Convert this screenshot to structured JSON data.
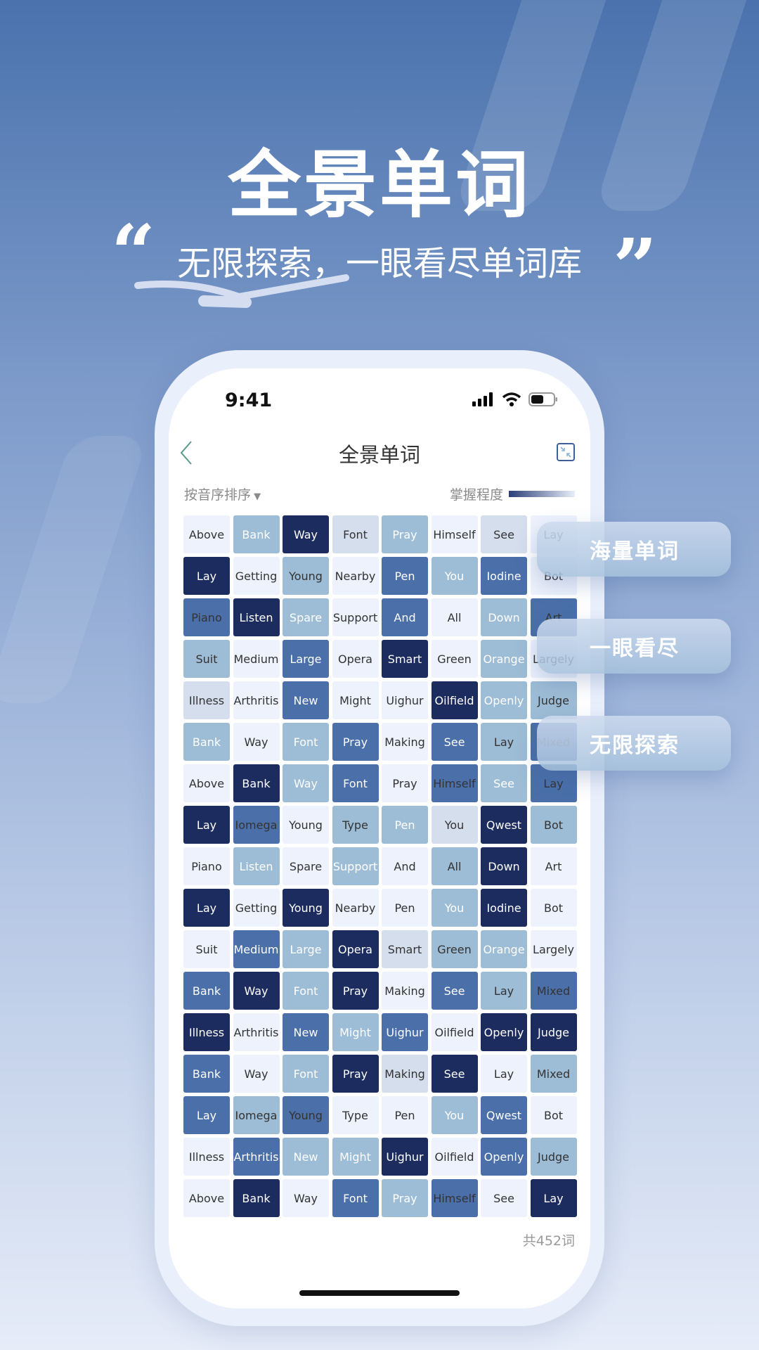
{
  "hero": {
    "title": "全景单词",
    "subtitle": "无限探索，一眼看尽单词库",
    "open_quote": "“",
    "close_quote": "”"
  },
  "status_bar": {
    "time": "9:41",
    "icons": [
      "signal-icon",
      "wifi-icon",
      "battery-icon"
    ]
  },
  "nav": {
    "title": "全景单词",
    "back_icon": "chevron-left-icon",
    "action_icon": "collapse-icon"
  },
  "toolbar": {
    "sort_label": "按音序排序",
    "sort_icon": "caret-down-icon",
    "legend_label": "掌握程度"
  },
  "colors": {
    "level0": "#edf2fc",
    "level1": "#d5deed",
    "level2": "#9dbcd6",
    "level3": "#4a6fa9",
    "level4": "#1c2c5e",
    "accent": "#4a72ad"
  },
  "grid": [
    [
      [
        "Above",
        0,
        "d"
      ],
      [
        "Bank",
        2,
        "w"
      ],
      [
        "Way",
        4,
        "w"
      ],
      [
        "Font",
        1,
        "d"
      ],
      [
        "Pray",
        2,
        "w"
      ],
      [
        "Himself",
        0,
        "d"
      ],
      [
        "See",
        1,
        "d"
      ],
      [
        "Lay",
        0,
        "d"
      ]
    ],
    [
      [
        "Lay",
        4,
        "w"
      ],
      [
        "Getting",
        0,
        "d"
      ],
      [
        "Young",
        2,
        "d"
      ],
      [
        "Nearby",
        0,
        "d"
      ],
      [
        "Pen",
        3,
        "w"
      ],
      [
        "You",
        2,
        "w"
      ],
      [
        "Iodine",
        3,
        "w"
      ],
      [
        "Bot",
        0,
        "d"
      ]
    ],
    [
      [
        "Piano",
        3,
        "d"
      ],
      [
        "Listen",
        4,
        "w"
      ],
      [
        "Spare",
        2,
        "w"
      ],
      [
        "Support",
        0,
        "d"
      ],
      [
        "And",
        3,
        "w"
      ],
      [
        "All",
        0,
        "d"
      ],
      [
        "Down",
        2,
        "w"
      ],
      [
        "Art",
        3,
        "d"
      ]
    ],
    [
      [
        "Suit",
        2,
        "d"
      ],
      [
        "Medium",
        0,
        "d"
      ],
      [
        "Large",
        3,
        "w"
      ],
      [
        "Opera",
        0,
        "d"
      ],
      [
        "Smart",
        4,
        "w"
      ],
      [
        "Green",
        0,
        "d"
      ],
      [
        "Orange",
        2,
        "w"
      ],
      [
        "Largely",
        0,
        "d"
      ]
    ],
    [
      [
        "Illness",
        1,
        "d"
      ],
      [
        "Arthritis",
        0,
        "d"
      ],
      [
        "New",
        3,
        "w"
      ],
      [
        "Might",
        0,
        "d"
      ],
      [
        "Uighur",
        0,
        "d"
      ],
      [
        "Oilfield",
        4,
        "w"
      ],
      [
        "Openly",
        2,
        "w"
      ],
      [
        "Judge",
        2,
        "d"
      ]
    ],
    [
      [
        "Bank",
        2,
        "w"
      ],
      [
        "Way",
        0,
        "d"
      ],
      [
        "Font",
        2,
        "w"
      ],
      [
        "Pray",
        3,
        "w"
      ],
      [
        "Making",
        0,
        "d"
      ],
      [
        "See",
        3,
        "w"
      ],
      [
        "Lay",
        2,
        "d"
      ],
      [
        "Mixed",
        3,
        "d"
      ]
    ],
    [
      [
        "Above",
        0,
        "d"
      ],
      [
        "Bank",
        4,
        "w"
      ],
      [
        "Way",
        2,
        "w"
      ],
      [
        "Font",
        3,
        "w"
      ],
      [
        "Pray",
        0,
        "d"
      ],
      [
        "Himself",
        3,
        "d"
      ],
      [
        "See",
        2,
        "w"
      ],
      [
        "Lay",
        3,
        "d"
      ]
    ],
    [
      [
        "Lay",
        4,
        "w"
      ],
      [
        "Iomega",
        3,
        "d"
      ],
      [
        "Young",
        0,
        "d"
      ],
      [
        "Type",
        2,
        "d"
      ],
      [
        "Pen",
        2,
        "w"
      ],
      [
        "You",
        1,
        "d"
      ],
      [
        "Qwest",
        4,
        "w"
      ],
      [
        "Bot",
        2,
        "d"
      ]
    ],
    [
      [
        "Piano",
        0,
        "d"
      ],
      [
        "Listen",
        2,
        "w"
      ],
      [
        "Spare",
        0,
        "d"
      ],
      [
        "Support",
        2,
        "w"
      ],
      [
        "And",
        0,
        "d"
      ],
      [
        "All",
        2,
        "d"
      ],
      [
        "Down",
        4,
        "w"
      ],
      [
        "Art",
        0,
        "d"
      ]
    ],
    [
      [
        "Lay",
        4,
        "w"
      ],
      [
        "Getting",
        0,
        "d"
      ],
      [
        "Young",
        4,
        "w"
      ],
      [
        "Nearby",
        0,
        "d"
      ],
      [
        "Pen",
        0,
        "d"
      ],
      [
        "You",
        2,
        "w"
      ],
      [
        "Iodine",
        4,
        "w"
      ],
      [
        "Bot",
        0,
        "d"
      ]
    ],
    [
      [
        "Suit",
        0,
        "d"
      ],
      [
        "Medium",
        3,
        "w"
      ],
      [
        "Large",
        2,
        "w"
      ],
      [
        "Opera",
        4,
        "w"
      ],
      [
        "Smart",
        1,
        "d"
      ],
      [
        "Green",
        2,
        "d"
      ],
      [
        "Orange",
        2,
        "w"
      ],
      [
        "Largely",
        0,
        "d"
      ]
    ],
    [
      [
        "Bank",
        3,
        "w"
      ],
      [
        "Way",
        4,
        "w"
      ],
      [
        "Font",
        2,
        "w"
      ],
      [
        "Pray",
        4,
        "w"
      ],
      [
        "Making",
        0,
        "d"
      ],
      [
        "See",
        3,
        "w"
      ],
      [
        "Lay",
        2,
        "d"
      ],
      [
        "Mixed",
        3,
        "d"
      ]
    ],
    [
      [
        "Illness",
        4,
        "w"
      ],
      [
        "Arthritis",
        0,
        "d"
      ],
      [
        "New",
        3,
        "w"
      ],
      [
        "Might",
        2,
        "w"
      ],
      [
        "Uighur",
        3,
        "w"
      ],
      [
        "Oilfield",
        0,
        "d"
      ],
      [
        "Openly",
        4,
        "w"
      ],
      [
        "Judge",
        4,
        "w"
      ]
    ],
    [
      [
        "Bank",
        3,
        "w"
      ],
      [
        "Way",
        0,
        "d"
      ],
      [
        "Font",
        2,
        "w"
      ],
      [
        "Pray",
        4,
        "w"
      ],
      [
        "Making",
        1,
        "d"
      ],
      [
        "See",
        4,
        "w"
      ],
      [
        "Lay",
        0,
        "d"
      ],
      [
        "Mixed",
        2,
        "d"
      ]
    ],
    [
      [
        "Lay",
        3,
        "w"
      ],
      [
        "Iomega",
        2,
        "d"
      ],
      [
        "Young",
        3,
        "d"
      ],
      [
        "Type",
        0,
        "d"
      ],
      [
        "Pen",
        0,
        "d"
      ],
      [
        "You",
        2,
        "w"
      ],
      [
        "Qwest",
        3,
        "w"
      ],
      [
        "Bot",
        0,
        "d"
      ]
    ],
    [
      [
        "Illness",
        0,
        "d"
      ],
      [
        "Arthritis",
        3,
        "w"
      ],
      [
        "New",
        2,
        "w"
      ],
      [
        "Might",
        2,
        "w"
      ],
      [
        "Uighur",
        4,
        "w"
      ],
      [
        "Oilfield",
        0,
        "d"
      ],
      [
        "Openly",
        3,
        "w"
      ],
      [
        "Judge",
        2,
        "d"
      ]
    ],
    [
      [
        "Above",
        0,
        "d"
      ],
      [
        "Bank",
        4,
        "w"
      ],
      [
        "Way",
        0,
        "d"
      ],
      [
        "Font",
        3,
        "w"
      ],
      [
        "Pray",
        2,
        "w"
      ],
      [
        "Himself",
        3,
        "d"
      ],
      [
        "See",
        0,
        "d"
      ],
      [
        "Lay",
        4,
        "w"
      ]
    ]
  ],
  "footer": {
    "total": "共452词"
  },
  "feature_cards": [
    "海量单词",
    "一眼看尽",
    "无限探索"
  ]
}
